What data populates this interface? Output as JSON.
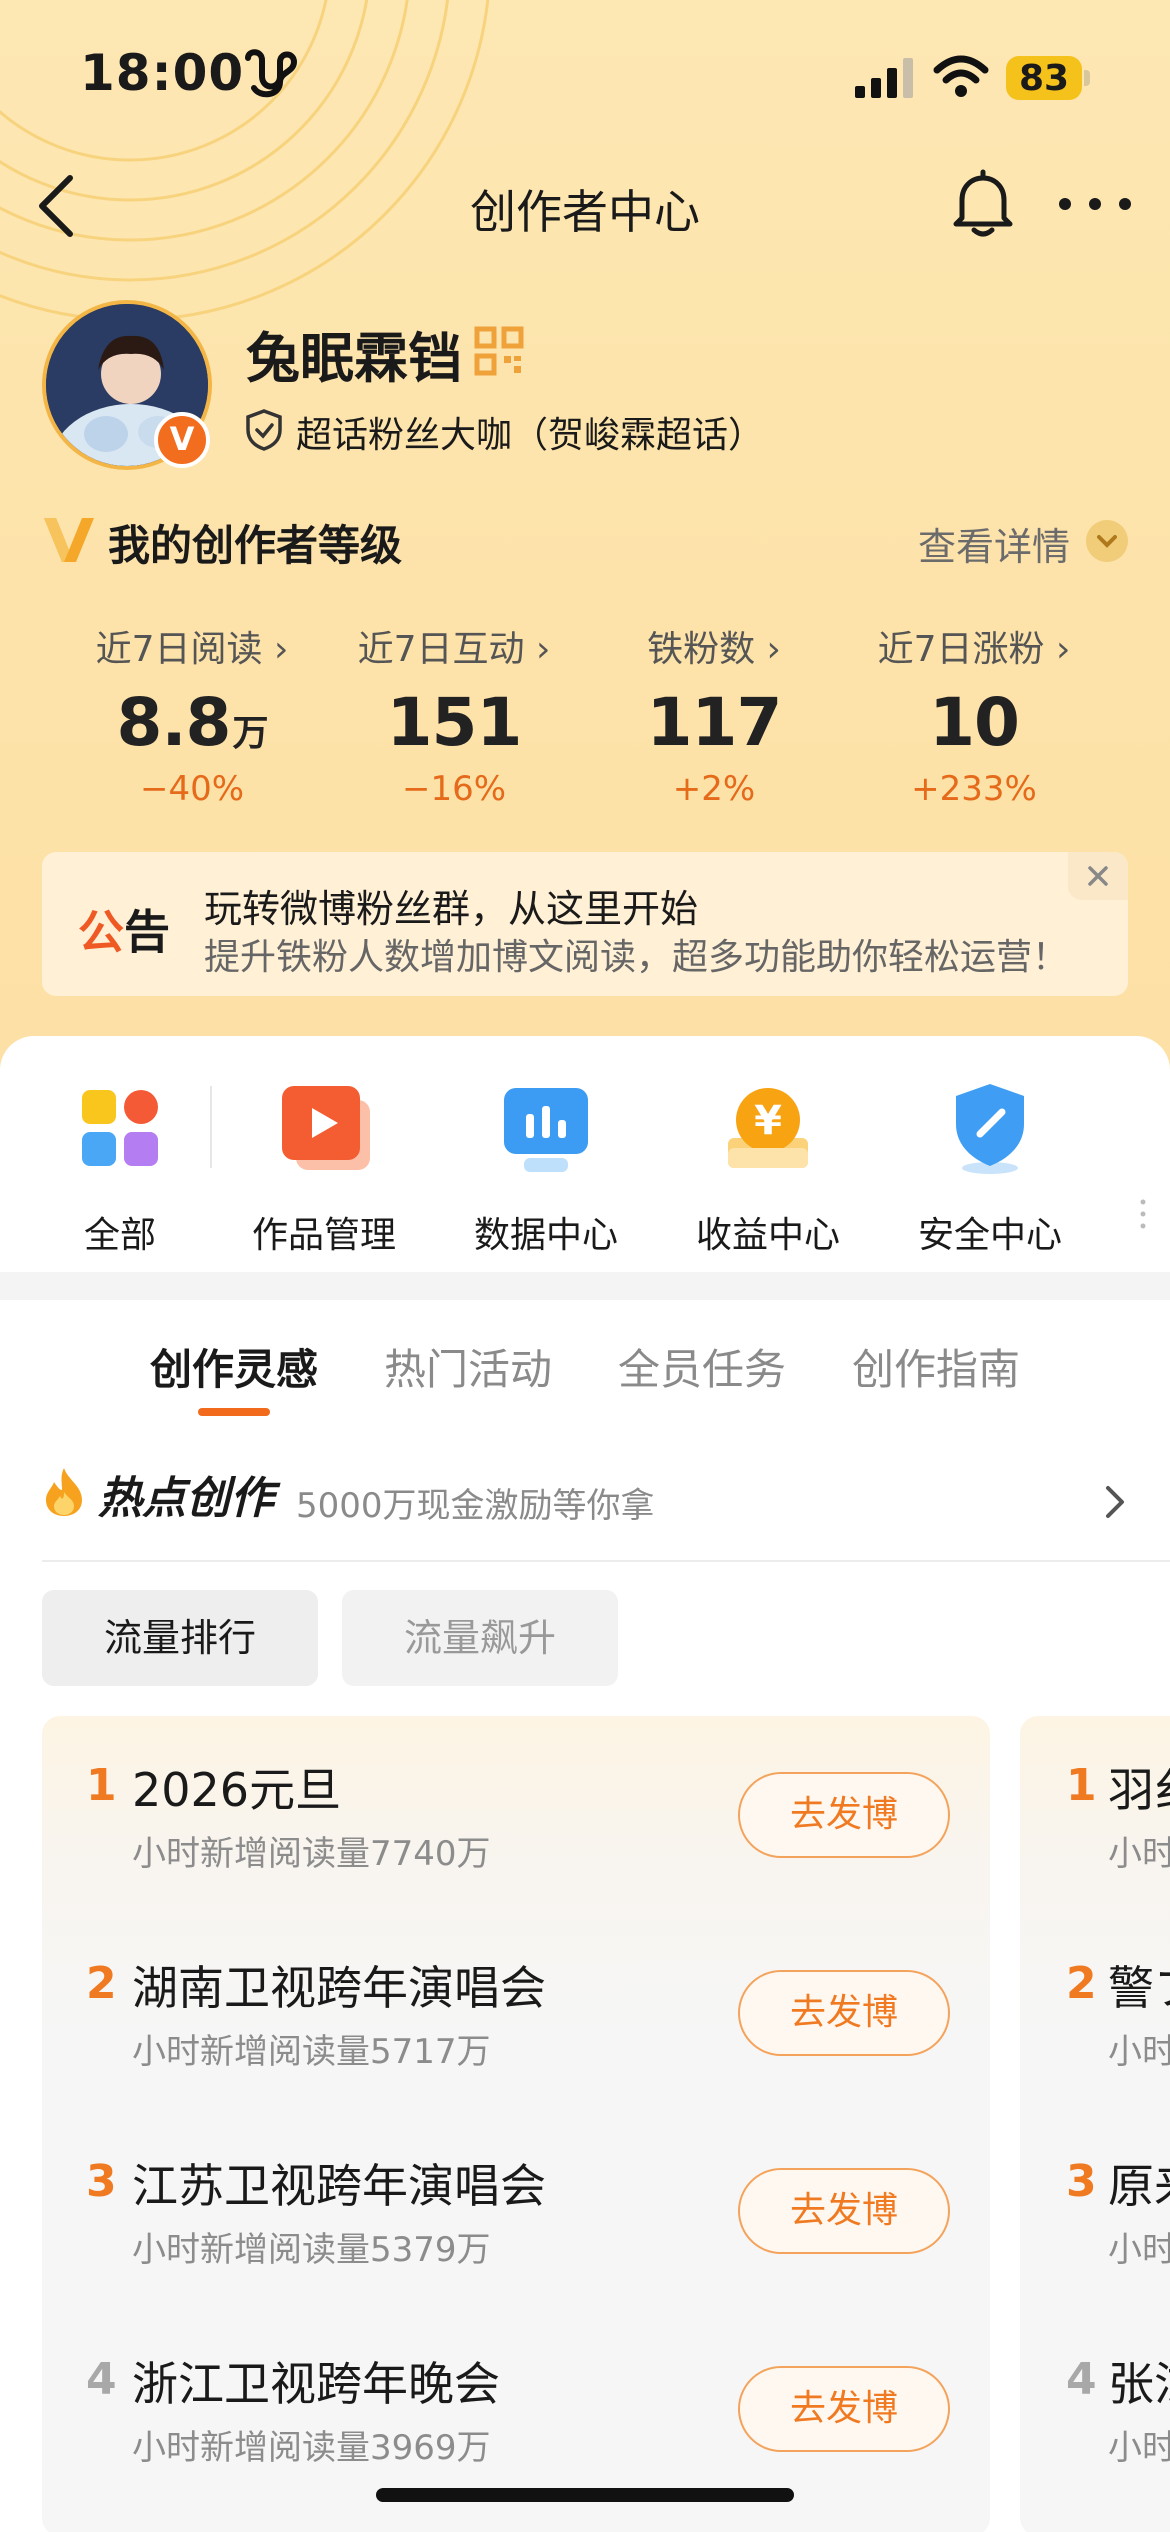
{
  "status_bar": {
    "time": "18:00",
    "battery": "83"
  },
  "nav": {
    "title": "创作者中心"
  },
  "profile": {
    "username": "兔眠霖铛",
    "fan_title": "超话粉丝大咖（贺峻霖超话）",
    "badge": "V"
  },
  "level": {
    "title": "我的创作者等级",
    "details": "查看详情"
  },
  "stats": [
    {
      "label": "近7日阅读 ›",
      "value": "8.8",
      "unit": "万",
      "change": "−40%"
    },
    {
      "label": "近7日互动 ›",
      "value": "151",
      "unit": "",
      "change": "−16%"
    },
    {
      "label": "铁粉数 ›",
      "value": "117",
      "unit": "",
      "change": "+2%"
    },
    {
      "label": "近7日涨粉 ›",
      "value": "10",
      "unit": "",
      "change": "+233%"
    }
  ],
  "notice": {
    "tag_a": "公",
    "tag_b": "告",
    "line1": "玩转微博粉丝群，从这里开始",
    "line2": "提升铁粉人数增加博文阅读，超多功能助你轻松运营！"
  },
  "tools": [
    {
      "label": "全部",
      "icon": "grid-icon"
    },
    {
      "label": "作品管理",
      "icon": "video-icon"
    },
    {
      "label": "数据中心",
      "icon": "chart-icon"
    },
    {
      "label": "收益中心",
      "icon": "yuan-coin-icon"
    },
    {
      "label": "安全中心",
      "icon": "shield-icon"
    }
  ],
  "tabs": [
    "创作灵感",
    "热门活动",
    "全员任务",
    "创作指南"
  ],
  "hot": {
    "title": "热点创作",
    "subtitle": "5000万现金激励等你拿"
  },
  "pills": [
    "流量排行",
    "流量飙升"
  ],
  "ranking": [
    {
      "num": "1",
      "title": "2026元旦",
      "sub": "小时新增阅读量7740万",
      "button": "去发博"
    },
    {
      "num": "2",
      "title": "湖南卫视跨年演唱会",
      "sub": "小时新增阅读量5717万",
      "button": "去发博"
    },
    {
      "num": "3",
      "title": "江苏卫视跨年演唱会",
      "sub": "小时新增阅读量5379万",
      "button": "去发博"
    },
    {
      "num": "4",
      "title": "浙江卫视跨年晚会",
      "sub": "小时新增阅读量3969万",
      "button": "去发博"
    }
  ],
  "ranking2": [
    {
      "num": "1",
      "title": "羽纟",
      "sub": "小时"
    },
    {
      "num": "2",
      "title": "警ブ",
      "sub": "小时"
    },
    {
      "num": "3",
      "title": "原来",
      "sub": "小时"
    },
    {
      "num": "4",
      "title": "张泫",
      "sub": "小时"
    }
  ],
  "colors": {
    "accent": "#f07a22",
    "header_bg": "#fde4ac",
    "notice_bg": "#fff0d6"
  }
}
